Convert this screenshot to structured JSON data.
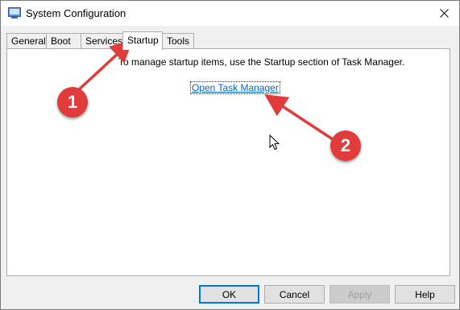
{
  "window": {
    "title": "System Configuration",
    "icon": "msconfig-icon"
  },
  "tabs": [
    {
      "label": "General",
      "active": false
    },
    {
      "label": "Boot",
      "active": false
    },
    {
      "label": "Services",
      "active": false
    },
    {
      "label": "Startup",
      "active": true
    },
    {
      "label": "Tools",
      "active": false
    }
  ],
  "startup": {
    "info_text": "To manage startup items, use the Startup section of Task Manager.",
    "link_text": "Open Task Manager"
  },
  "buttons": {
    "ok": "OK",
    "cancel": "Cancel",
    "apply": "Apply",
    "help": "Help"
  },
  "annotations": {
    "marker1": "1",
    "marker2": "2",
    "color": "#e23b3b"
  }
}
